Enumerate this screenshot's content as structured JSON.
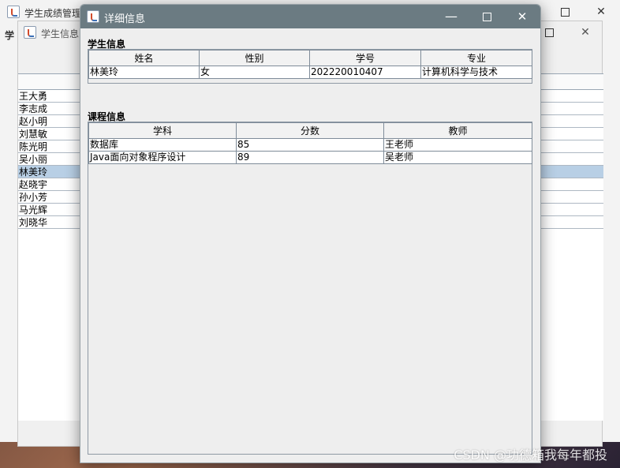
{
  "window_back": {
    "title": "学生成绩管理",
    "left_label": "学"
  },
  "window_mid": {
    "title": "学生信息",
    "students": [
      "王大勇",
      "李志成",
      "赵小明",
      "刘慧敏",
      "陈光明",
      "吴小丽",
      "林美玲",
      "赵晓宇",
      "孙小芳",
      "马光辉",
      "刘晓华"
    ],
    "selected_index": 6
  },
  "dialog": {
    "title": "详细信息",
    "student_section": {
      "label": "学生信息",
      "columns": [
        "姓名",
        "性别",
        "学号",
        "专业"
      ],
      "row": [
        "林美玲",
        "女",
        "202220010407",
        "计算机科学与技术"
      ]
    },
    "course_section": {
      "label": "课程信息",
      "columns": [
        "学科",
        "分数",
        "教师"
      ],
      "rows": [
        [
          "数据库",
          "85",
          "王老师"
        ],
        [
          "Java面向对象程序设计",
          "89",
          "吴老师"
        ]
      ]
    }
  },
  "watermark": "CSDN @功德箱我每年都投",
  "icons": {
    "app": "java-app-icon",
    "minimize": "minimize-icon",
    "maximize": "maximize-icon",
    "close": "close-icon"
  }
}
